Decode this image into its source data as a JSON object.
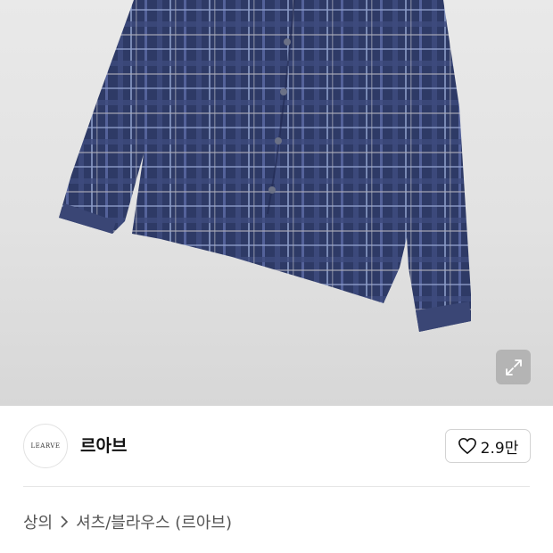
{
  "hero": {
    "image_desc_icon": "plaid-shirt-photo",
    "expand_icon": "expand-icon"
  },
  "brand": {
    "logo_text": "LEARVE",
    "name": "르아브"
  },
  "like": {
    "icon": "heart-icon",
    "count": "2.9만"
  },
  "breadcrumb": {
    "items": [
      "상의",
      "셔츠/블라우스 (르아브)"
    ],
    "separator_icon": "chevron-right-icon"
  },
  "colors": {
    "shirt_base": "#2e3a66",
    "shirt_check": "#6d7fae",
    "border": "#d3d3d3",
    "text": "#111111",
    "muted": "#555555"
  }
}
